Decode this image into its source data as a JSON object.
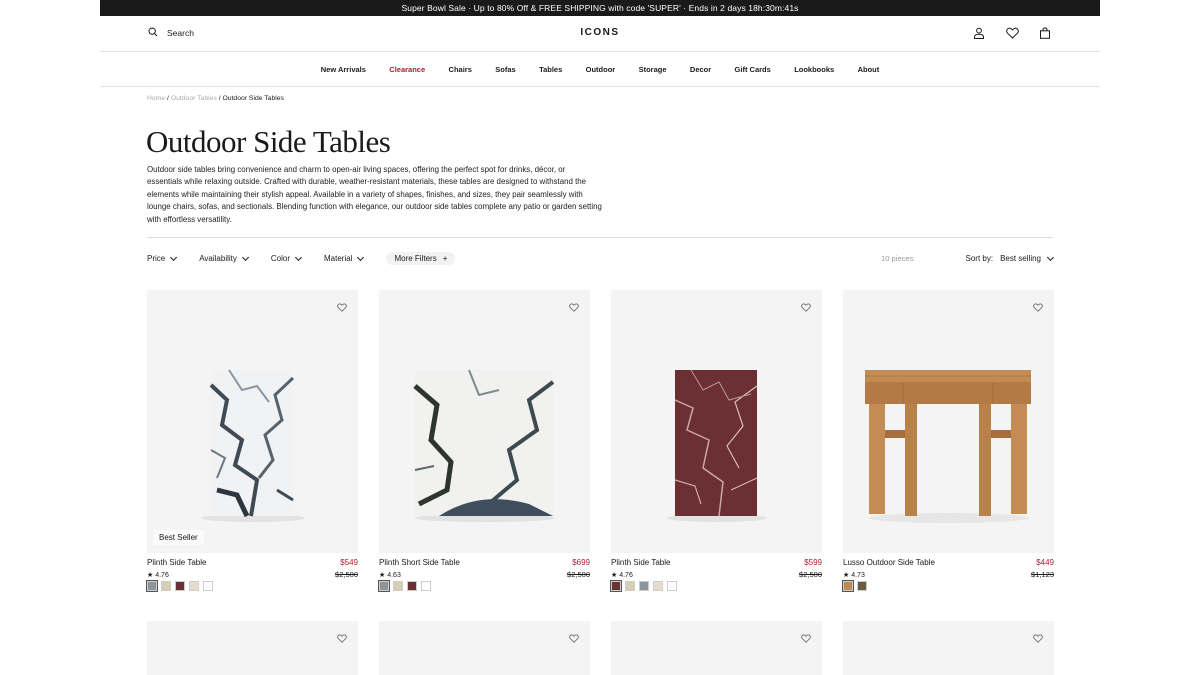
{
  "promo": {
    "text": "Super Bowl Sale · Up to 80% Off & FREE SHIPPING with code 'SUPER'   · Ends in 2 days 18h:30m:41s"
  },
  "header": {
    "search_label": "Search",
    "logo": "ICONS",
    "icons": [
      "account-icon",
      "wishlist-heart-icon",
      "bag-icon"
    ]
  },
  "nav": {
    "items": [
      "New Arrivals",
      "Clearance",
      "Chairs",
      "Sofas",
      "Tables",
      "Outdoor",
      "Storage",
      "Decor",
      "Gift Cards",
      "Lookbooks",
      "About"
    ],
    "highlight_color": "#b01b2e"
  },
  "breadcrumb": {
    "home": "Home",
    "parent": "Outdoor Tables",
    "current": "Outdoor Side Tables"
  },
  "page": {
    "title": "Outdoor Side Tables",
    "description": "Outdoor side tables bring convenience and charm to open-air living spaces, offering the perfect spot for drinks, décor, or essentials while relaxing outside. Crafted with durable, weather-resistant materials, these tables are designed to withstand the elements while maintaining their stylish appeal. Available in a variety of shapes, finishes, and sizes, they pair seamlessly with lounge chairs, sofas, and sectionals. Blending function with elegance, our outdoor side tables complete any patio or garden setting with effortless versatility."
  },
  "filters": {
    "price": "Price",
    "availability": "Availability",
    "color": "Color",
    "material": "Material",
    "more": "More Filters",
    "more_symbol": "+",
    "count": "10 pieces",
    "sort_label": "Sort by:",
    "sort_value": "Best selling"
  },
  "products": [
    {
      "name": "Plinth Side Table",
      "price": "$549",
      "was": "$2,500",
      "rating": "★ 4.76",
      "badge": "Best Seller",
      "image": "white-blue-marble-cube",
      "swatches": [
        "#8d959b",
        "#d8cdb6",
        "#6b3236",
        "#e6dccb",
        "#ffffff"
      ]
    },
    {
      "name": "Plinth Short Side Table",
      "price": "$699",
      "was": "$2,500",
      "rating": "★ 4.63",
      "badge": "",
      "image": "white-dark-marble-cube",
      "swatches": [
        "#8d959b",
        "#d8cdb6",
        "#6b3236",
        "#ffffff"
      ]
    },
    {
      "name": "Plinth Side Table",
      "price": "$599",
      "was": "$2,500",
      "rating": "★ 4.76",
      "badge": "",
      "image": "red-marble-cube",
      "swatches": [
        "#6b3236",
        "#d8cdb6",
        "#8d959b",
        "#e6dccb",
        "#ffffff"
      ]
    },
    {
      "name": "Lusso Outdoor Side Table",
      "price": "$449",
      "was": "$1,123",
      "rating": "★ 4.73",
      "badge": "",
      "image": "teak-wood-table",
      "swatches": [
        "#c08a55",
        "#6b5a45"
      ]
    }
  ]
}
